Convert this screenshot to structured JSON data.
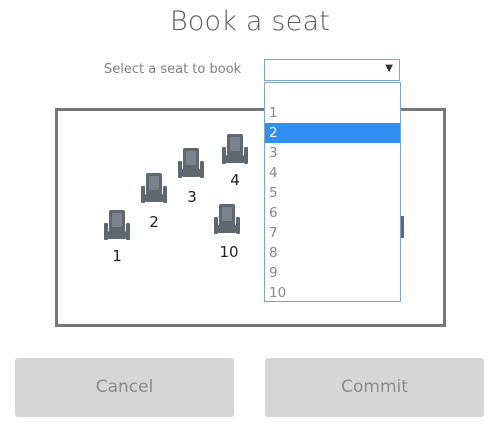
{
  "title": "Book a seat",
  "select": {
    "label": "Select a seat to book",
    "value": "",
    "arrow_icon": "triangle-down-icon"
  },
  "dropdown": {
    "options": [
      "1",
      "2",
      "3",
      "4",
      "5",
      "6",
      "7",
      "8",
      "9",
      "10"
    ],
    "highlighted": "2"
  },
  "seats": [
    {
      "number": "1"
    },
    {
      "number": "2"
    },
    {
      "number": "3"
    },
    {
      "number": "4"
    },
    {
      "number": "10"
    }
  ],
  "buttons": {
    "cancel": "Cancel",
    "commit": "Commit"
  },
  "colors": {
    "seat": "#5f6770",
    "highlight": "#2f8ff4",
    "button_bg": "#d6d6d6"
  }
}
